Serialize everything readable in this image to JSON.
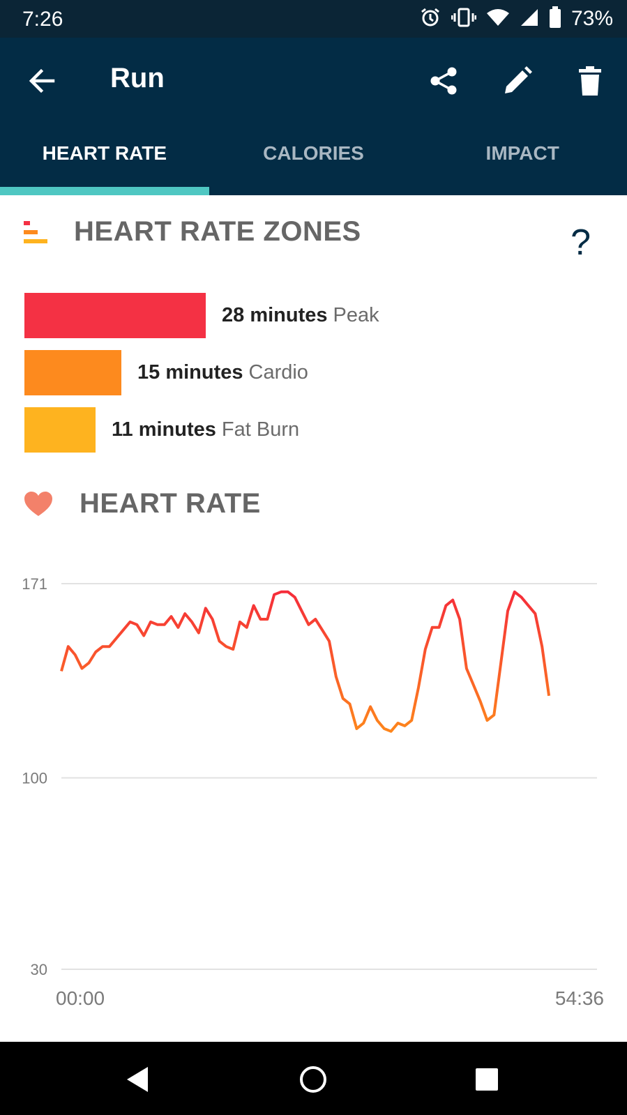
{
  "status_bar": {
    "time": "7:26",
    "battery": "73%"
  },
  "app_bar": {
    "title": "Run"
  },
  "tabs": [
    {
      "label": "HEART RATE",
      "active": true
    },
    {
      "label": "CALORIES",
      "active": false
    },
    {
      "label": "IMPACT",
      "active": false
    }
  ],
  "zones_section": {
    "title": "HEART RATE ZONES",
    "help": "?",
    "zones": [
      {
        "minutes": "28 minutes",
        "name": "Peak",
        "value": 28,
        "color": "#f43144"
      },
      {
        "minutes": "15 minutes",
        "name": "Cardio",
        "value": 15,
        "color": "#fd8a1e"
      },
      {
        "minutes": "11 minutes",
        "name": "Fat Burn",
        "value": 11,
        "color": "#feb31f"
      }
    ]
  },
  "heart_rate_section": {
    "title": "HEART RATE"
  },
  "chart_data": {
    "type": "line",
    "title": "HEART RATE",
    "xlabel": "",
    "ylabel": "",
    "y_ticks": [
      "171",
      "100",
      "30"
    ],
    "ylim": [
      30,
      171
    ],
    "x_ticks": [
      "00:00",
      "54:36"
    ],
    "xlim_minutes": [
      0,
      54.6
    ],
    "grid": true,
    "color_high": "#f4203e",
    "color_low": "#fe8a1a",
    "x": [
      0,
      0.7,
      1.4,
      2.1,
      2.8,
      3.5,
      4.2,
      4.9,
      5.6,
      6.3,
      7.0,
      7.7,
      8.4,
      9.1,
      9.8,
      10.5,
      11.2,
      11.9,
      12.6,
      13.3,
      14.0,
      14.7,
      15.4,
      16.1,
      16.8,
      17.5,
      18.2,
      18.9,
      19.6,
      20.3,
      21.0,
      21.7,
      22.4,
      23.1,
      23.8,
      24.5,
      25.2,
      25.9,
      26.6,
      27.3,
      28.0,
      28.7,
      29.4,
      30.1,
      30.8,
      31.5,
      32.2,
      32.9,
      33.6,
      34.3,
      35.0,
      35.7,
      36.4,
      37.1,
      37.8,
      38.5,
      39.2,
      39.9,
      40.6,
      41.3,
      42.0,
      42.7,
      43.4,
      44.1,
      44.8,
      45.5,
      46.2,
      46.9,
      47.6,
      48.3,
      49.0,
      49.7,
      50.4,
      51.1,
      51.8,
      52.5,
      53.2,
      53.9,
      54.6
    ],
    "y": [
      139,
      148,
      145,
      140,
      142,
      146,
      148,
      148,
      151,
      154,
      157,
      156,
      152,
      157,
      156,
      156,
      159,
      155,
      160,
      157,
      153,
      162,
      158,
      150,
      148,
      147,
      157,
      155,
      163,
      158,
      158,
      167,
      168,
      168,
      166,
      161,
      156,
      158,
      154,
      150,
      137,
      129,
      127,
      118,
      120,
      126,
      121,
      118,
      117,
      120,
      119,
      121,
      133,
      147,
      155,
      155,
      163,
      165,
      158,
      140,
      134,
      128,
      121,
      123,
      142,
      161,
      168,
      166,
      163,
      160,
      148,
      130
    ]
  }
}
